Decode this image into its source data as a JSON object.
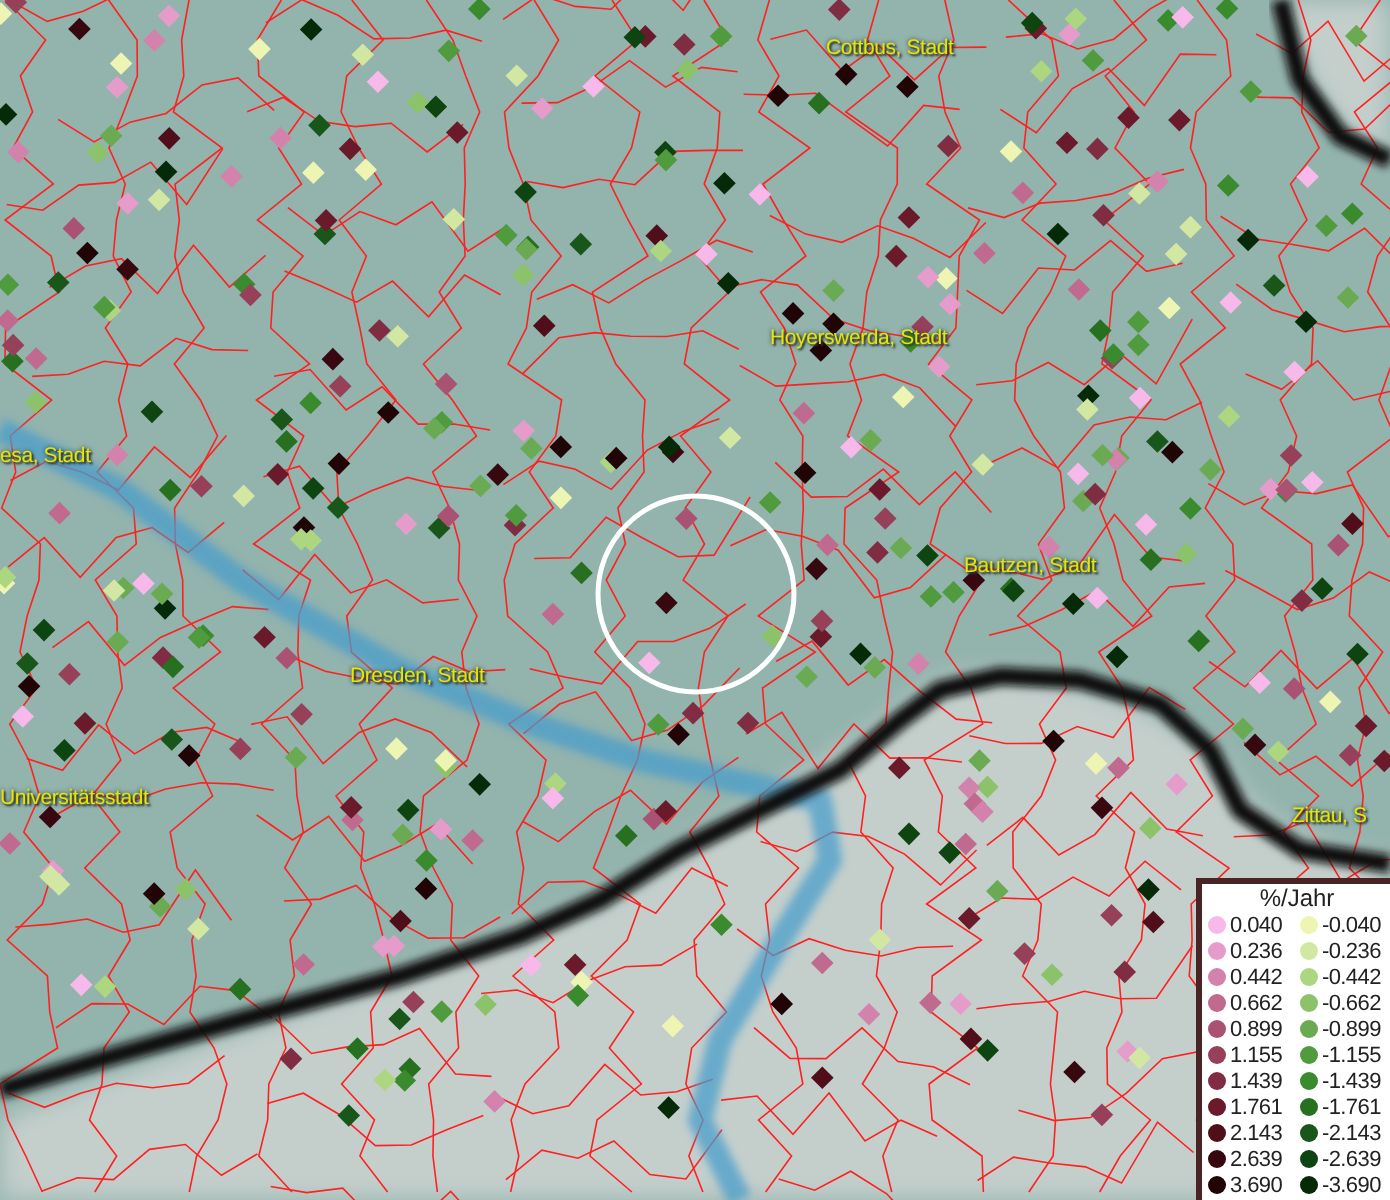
{
  "map": {
    "places": [
      {
        "kind": "city",
        "name": "Cottbus, Stadt"
      },
      {
        "kind": "city",
        "name": "Hoyerswerda, Stadt"
      },
      {
        "kind": "city",
        "name": "esa, Stadt"
      },
      {
        "kind": "city",
        "name": "Bautzen, Stadt"
      },
      {
        "kind": "city",
        "name": "Dresden, Stadt"
      },
      {
        "kind": "city",
        "name": "Universitätsstadt"
      },
      {
        "kind": "city",
        "name": "Zittau, S"
      }
    ]
  },
  "legend": {
    "title": "%/Jahr",
    "rows": [
      {
        "positive": {
          "label": "0.040",
          "color": "#f7b8ea"
        },
        "negative": {
          "label": "-0.040",
          "color": "#eef5b2"
        }
      },
      {
        "positive": {
          "label": "0.236",
          "color": "#e69ccb"
        },
        "negative": {
          "label": "-0.236",
          "color": "#d2e8a2"
        }
      },
      {
        "positive": {
          "label": "0.442",
          "color": "#d282ab"
        },
        "negative": {
          "label": "-0.442",
          "color": "#add680"
        }
      },
      {
        "positive": {
          "label": "0.662",
          "color": "#c06a90"
        },
        "negative": {
          "label": "-0.662",
          "color": "#8cc26a"
        }
      },
      {
        "positive": {
          "label": "0.899",
          "color": "#aa5272"
        },
        "negative": {
          "label": "-0.899",
          "color": "#6aaa52"
        }
      },
      {
        "positive": {
          "label": "1.155",
          "color": "#96405a"
        },
        "negative": {
          "label": "-1.155",
          "color": "#4f9b3d"
        }
      },
      {
        "positive": {
          "label": "1.439",
          "color": "#802c42"
        },
        "negative": {
          "label": "-1.439",
          "color": "#3a8a2e"
        }
      },
      {
        "positive": {
          "label": "1.761",
          "color": "#6a1a2a"
        },
        "negative": {
          "label": "-1.761",
          "color": "#26701f"
        }
      },
      {
        "positive": {
          "label": "2.143",
          "color": "#500e1a"
        },
        "negative": {
          "label": "-2.143",
          "color": "#18561a"
        }
      },
      {
        "positive": {
          "label": "2.639",
          "color": "#380810"
        },
        "negative": {
          "label": "-2.639",
          "color": "#0e4410"
        }
      },
      {
        "positive": {
          "label": "3.690",
          "color": "#200406"
        },
        "negative": {
          "label": "-3.690",
          "color": "#062a08"
        }
      }
    ]
  }
}
